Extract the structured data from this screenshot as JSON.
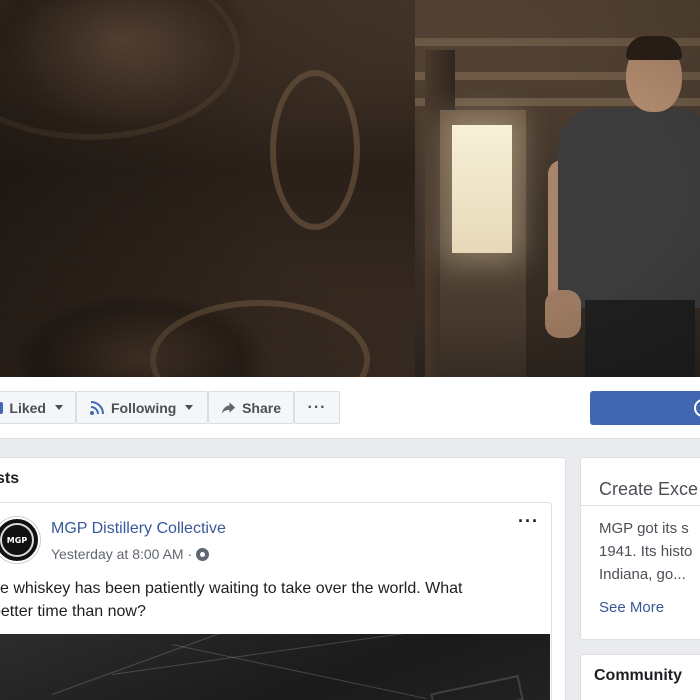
{
  "cover": {
    "description_icon": "cover-photo"
  },
  "action_bar": {
    "liked_label": "Liked",
    "following_label": "Following",
    "share_label": "Share",
    "more_label": "···"
  },
  "posts_section": {
    "heading": "sts"
  },
  "post": {
    "author": "MGP Distillery Collective",
    "timestamp": "Yesterday at 8:00 AM · ",
    "text_line1": "ye whiskey has been patiently waiting to take over the world. What",
    "text_line2": "better time than now?",
    "options_label": "···",
    "avatar_text": "MGP"
  },
  "sidebar": {
    "about_title": "Create Exce",
    "about_line1": "MGP got its s",
    "about_line2": "1941. Its histo",
    "about_line3": "Indiana, go...",
    "see_more": "See More",
    "community_title": "Community"
  },
  "colors": {
    "link_blue": "#385898",
    "brand_blue": "#4267b2",
    "page_bg": "#e9ebee"
  }
}
